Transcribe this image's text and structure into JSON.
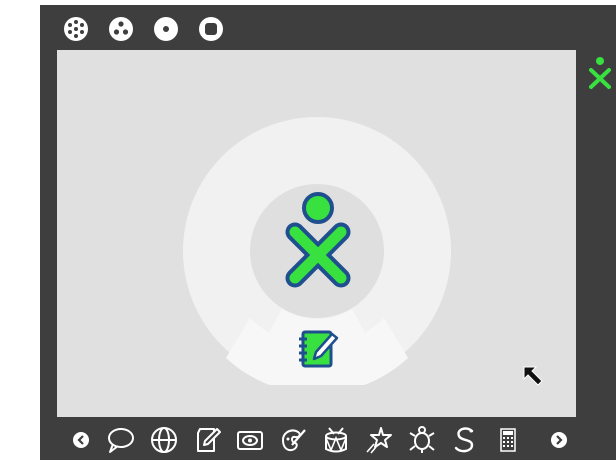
{
  "view": "home-ring",
  "zoom_views": [
    {
      "id": "neighborhood",
      "icon": "neighborhood-view-icon"
    },
    {
      "id": "group",
      "icon": "group-view-icon"
    },
    {
      "id": "home",
      "icon": "home-view-icon"
    },
    {
      "id": "activity",
      "icon": "activity-view-icon"
    }
  ],
  "owner": {
    "icon": "xo-owner-icon",
    "stroke_color": "#1f4f8e",
    "fill_color": "#38e13f"
  },
  "ring": {
    "activities": [
      {
        "id": "journal",
        "icon": "journal-icon"
      }
    ]
  },
  "buddy": {
    "icon": "xo-buddy-icon",
    "fill_color": "#38e13f"
  },
  "bottom_bar": {
    "left_arrow": "scroll-left-icon",
    "right_arrow": "scroll-right-icon",
    "activities": [
      {
        "id": "chat",
        "icon": "chat-icon"
      },
      {
        "id": "browse",
        "icon": "browse-icon"
      },
      {
        "id": "write",
        "icon": "write-icon"
      },
      {
        "id": "record",
        "icon": "record-icon"
      },
      {
        "id": "paint",
        "icon": "paint-icon"
      },
      {
        "id": "tamtam",
        "icon": "drum-icon"
      },
      {
        "id": "etoys",
        "icon": "etoys-icon"
      },
      {
        "id": "turtle",
        "icon": "turtle-icon"
      },
      {
        "id": "pippy",
        "icon": "pippy-icon"
      },
      {
        "id": "calculate",
        "icon": "calculate-icon"
      }
    ]
  },
  "colors": {
    "frame": "#3e3e3e",
    "stage": "#e0e0e0",
    "ring": "#f1f1f1",
    "hub": "#dfdfdf",
    "selected_slice": "#f7f7f7",
    "activity_green": "#38e13f",
    "activity_stroke": "#1f4f8e"
  }
}
